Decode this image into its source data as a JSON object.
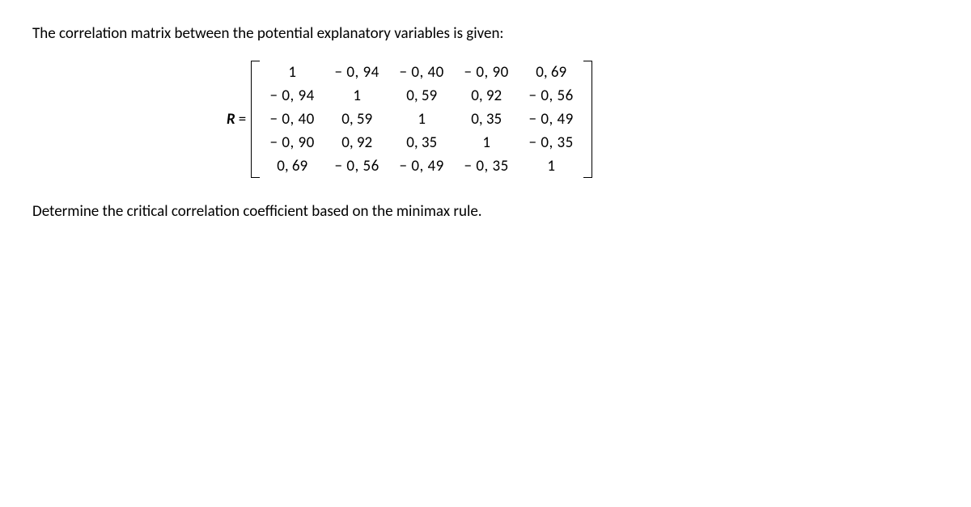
{
  "intro": "The correlation matrix between the potential explanatory variables is given:",
  "matrix_label": "R",
  "matrix_eq": "=",
  "matrix": {
    "rows": [
      [
        "1",
        "− 0, 94",
        "− 0, 40",
        "− 0, 90",
        "0, 69"
      ],
      [
        "− 0, 94",
        "1",
        "0, 59",
        "0, 92",
        "− 0, 56"
      ],
      [
        "− 0, 40",
        "0, 59",
        "1",
        "0, 35",
        "− 0, 49"
      ],
      [
        "− 0, 90",
        "0, 92",
        "0, 35",
        "1",
        "− 0, 35"
      ],
      [
        "0, 69",
        "− 0, 56",
        "− 0, 49",
        "− 0, 35",
        "1"
      ]
    ]
  },
  "question": "Determine the critical correlation coefficient based on the minimax rule."
}
